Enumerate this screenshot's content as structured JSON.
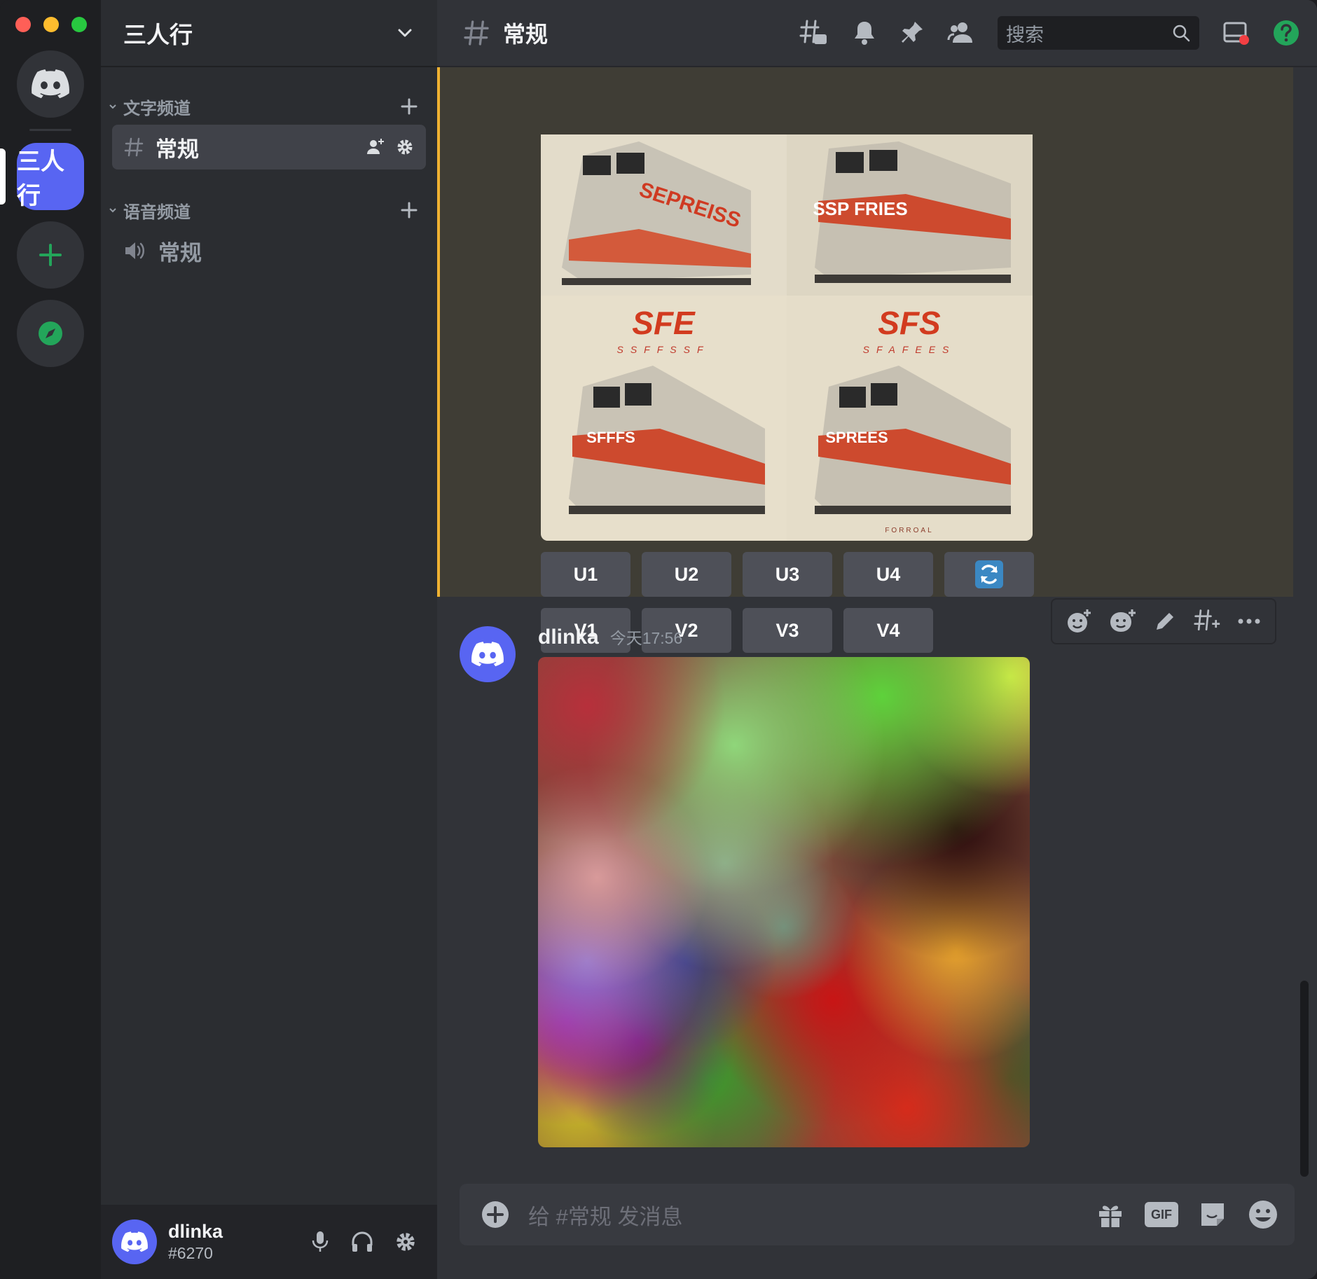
{
  "server": {
    "name": "三人行",
    "icon_label": "三人行"
  },
  "sidebar": {
    "categories": [
      {
        "label": "文字频道"
      },
      {
        "label": "语音频道"
      }
    ],
    "text_channel": {
      "name": "常规"
    },
    "voice_channel": {
      "name": "常规"
    }
  },
  "user_panel": {
    "username": "dlinka",
    "tag": "#6270"
  },
  "topbar": {
    "channel_name": "常规",
    "search_placeholder": "搜索"
  },
  "prior_message": {
    "image_tiles": [
      {
        "logo": "",
        "sublogo": "",
        "train_text": "SEPREISS",
        "caption": ""
      },
      {
        "logo": "",
        "sublogo": "",
        "train_text": "SSP FRIES",
        "caption": ""
      },
      {
        "logo": "SFE",
        "sublogo": "SSFFSSF",
        "train_text": "SFFFS",
        "caption": ""
      },
      {
        "logo": "SFS",
        "sublogo": "SFAFEES",
        "train_text": "SPREES",
        "caption": "FORROAL"
      }
    ],
    "upscale_buttons": [
      "U1",
      "U2",
      "U3",
      "U4"
    ],
    "variation_buttons": [
      "V1",
      "V2",
      "V3",
      "V4"
    ]
  },
  "message": {
    "author": "dlinka",
    "timestamp": "今天17:56"
  },
  "composer": {
    "placeholder": "给 #常规 发消息",
    "gif_label": "GIF"
  },
  "colors": {
    "brand": "#5865f2",
    "highlight_bar": "#f0b232",
    "help": "#23a55a"
  }
}
